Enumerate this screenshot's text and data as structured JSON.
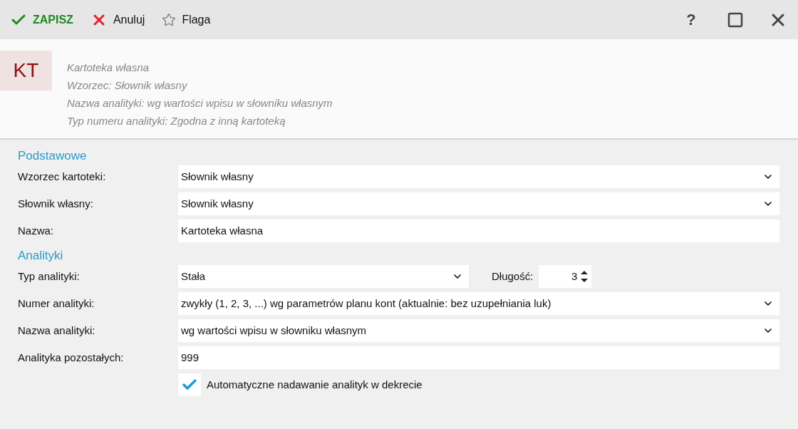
{
  "toolbar": {
    "actions": [
      {
        "kind": "save",
        "label": "ZAPISZ"
      },
      {
        "kind": "cancel",
        "label": "Anuluj"
      },
      {
        "kind": "flag",
        "label": "Flaga"
      }
    ],
    "window_buttons": [
      "?"
    ]
  },
  "header": {
    "badge": "KT",
    "lines": [
      "Kartoteka własna",
      "Wzorzec: Słownik własny",
      "Nazwa analityki: wg wartości wpisu w słowniku własnym",
      "Typ numeru analityki: Zgodna z inną kartoteką"
    ]
  },
  "sections": [
    {
      "title": "Podstawowe",
      "rows": [
        {
          "kind": "select",
          "label": "Wzorzec kartoteki:",
          "value": "Słownik własny"
        },
        {
          "kind": "select",
          "label": "Słownik własny:",
          "value": "Słownik własny"
        },
        {
          "kind": "text",
          "label": "Nazwa:",
          "value": "Kartoteka własna"
        }
      ]
    },
    {
      "title": "Analityki",
      "rows": [
        {
          "kind": "select_spin",
          "label": "Typ analityki:",
          "value": "Stała",
          "spin_label": "Długość:",
          "spin_value": "3"
        },
        {
          "kind": "select",
          "label": "Numer analityki:",
          "value": "zwykły (1, 2, 3, ...) wg parametrów planu kont (aktualnie: bez uzupełniania luk)"
        },
        {
          "kind": "select",
          "label": "Nazwa analityki:",
          "value": "wg wartości wpisu w słowniku własnym"
        },
        {
          "kind": "text",
          "label": "Analityka pozostałych:",
          "value": "999"
        },
        {
          "kind": "checkbox",
          "label": "Automatyczne nadawanie analityk w dekrecie",
          "checked": true
        }
      ]
    }
  ]
}
